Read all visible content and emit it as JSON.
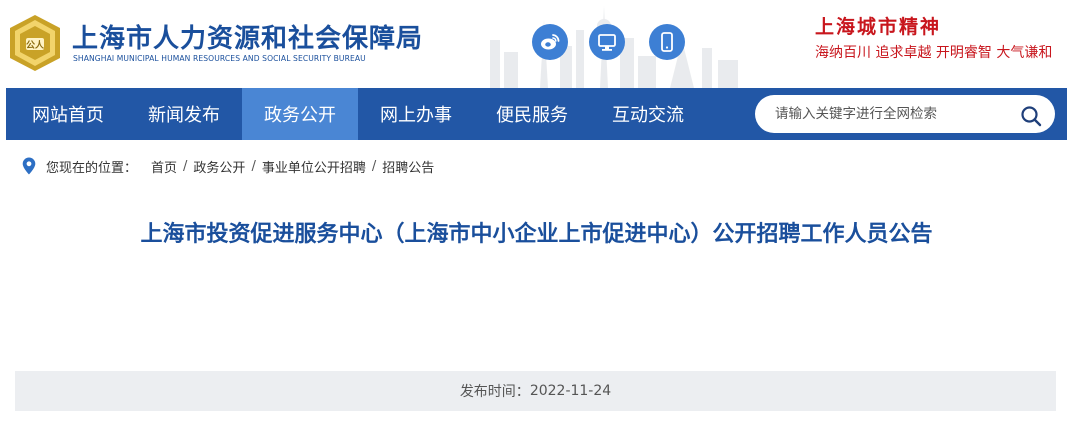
{
  "header": {
    "site_title": "上海市人力资源和社会保障局",
    "site_subtitle": "SHANGHAI MUNICIPAL HUMAN RESOURCES AND SOCIAL SECURITY BUREAU",
    "logo_text": "公人",
    "social": [
      {
        "icon": "weibo-icon"
      },
      {
        "icon": "desktop-icon"
      },
      {
        "icon": "mobile-icon"
      }
    ],
    "spirit_title": "上海城市精神",
    "spirit_motto": "海纳百川  追求卓越  开明睿智  大气谦和"
  },
  "nav": {
    "items": [
      {
        "label": "网站首页",
        "active": false
      },
      {
        "label": "新闻发布",
        "active": false
      },
      {
        "label": "政务公开",
        "active": true
      },
      {
        "label": "网上办事",
        "active": false
      },
      {
        "label": "便民服务",
        "active": false
      },
      {
        "label": "互动交流",
        "active": false
      }
    ],
    "search_placeholder": "请输入关键字进行全网检索"
  },
  "breadcrumb": {
    "lead": "您现在的位置：",
    "items": [
      "首页",
      "政务公开",
      "事业单位公开招聘",
      "招聘公告"
    ]
  },
  "article": {
    "title": "上海市投资促进服务中心（上海市中小企业上市促进中心）公开招聘工作人员公告",
    "publish_label": "发布时间：",
    "publish_date": "2022-11-24"
  },
  "colors": {
    "brand_blue": "#2257a6",
    "active_tab": "#4a86d4",
    "title_blue": "#1a4f9c",
    "accent_red": "#c8161d",
    "logo_gold": "#c9a227"
  }
}
